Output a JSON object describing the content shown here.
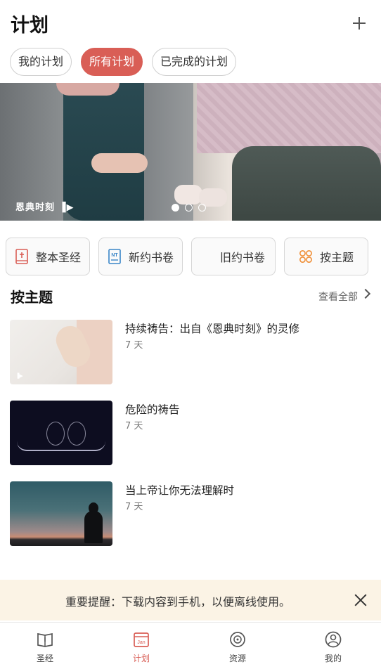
{
  "header": {
    "title": "计划"
  },
  "tabs": [
    {
      "label": "我的计划",
      "active": false
    },
    {
      "label": "所有计划",
      "active": true
    },
    {
      "label": "已完成的计划",
      "active": false
    }
  ],
  "banner": {
    "brand": "恩典时刻",
    "slide_count": 3,
    "current_slide": 1
  },
  "quick_filters": [
    {
      "label": "整本圣经",
      "icon": "bible-icon",
      "color": "#d95e56"
    },
    {
      "label": "新约书卷",
      "icon": "nt-icon",
      "color": "#3a86c8"
    },
    {
      "label": "旧约书卷",
      "icon": "ot-icon",
      "color": "#777777"
    },
    {
      "label": "按主题",
      "icon": "topics-icon",
      "color": "#f0923c"
    }
  ],
  "section": {
    "title": "按主题",
    "view_all": "查看全部"
  },
  "plans": [
    {
      "title": "持续祷告：出自《恩典时刻》的灵修",
      "days": "7 天"
    },
    {
      "title": "危险的祷告",
      "days": "7 天"
    },
    {
      "title": "当上帝让你无法理解时",
      "days": "7 天"
    }
  ],
  "notice": {
    "text": "重要提醒：下载内容到手机，以便离线使用。"
  },
  "bottom_nav": [
    {
      "label": "圣经",
      "icon": "bible-book-icon",
      "active": false
    },
    {
      "label": "计划",
      "icon": "calendar-icon",
      "active": true,
      "icon_text": "Jan"
    },
    {
      "label": "资源",
      "icon": "disc-icon",
      "active": false
    },
    {
      "label": "我的",
      "icon": "profile-icon",
      "active": false
    }
  ],
  "colors": {
    "accent": "#d95e56",
    "notice_bg": "#fbf3e5"
  }
}
